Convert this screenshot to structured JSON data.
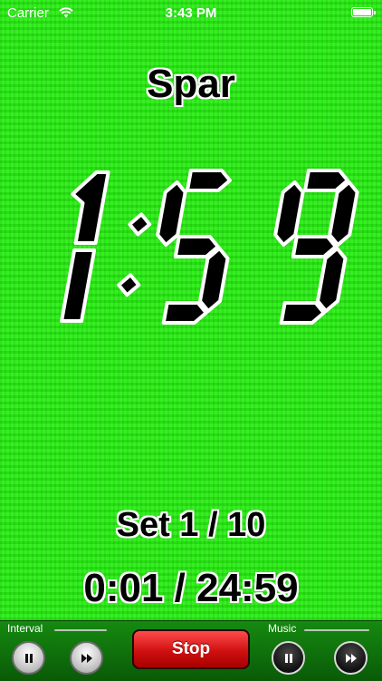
{
  "status_bar": {
    "carrier": "Carrier",
    "time": "3:43 PM"
  },
  "timer": {
    "phase_title": "Spar",
    "clock": "1:59",
    "set_counter": "Set 1 / 10",
    "elapsed": "0:01 / 24:59"
  },
  "toolbar": {
    "interval_label": "Interval",
    "music_label": "Music",
    "stop_label": "Stop"
  },
  "colors": {
    "background": "#2aee14",
    "toolbar": "#158a10",
    "stop_button": "#d81414",
    "digits": "#000000"
  },
  "icons": {
    "interval_pause": "pause-icon",
    "interval_next": "fast-forward-icon",
    "music_pause": "pause-icon",
    "music_next": "fast-forward-icon",
    "wifi": "wifi-icon",
    "battery": "battery-icon"
  }
}
